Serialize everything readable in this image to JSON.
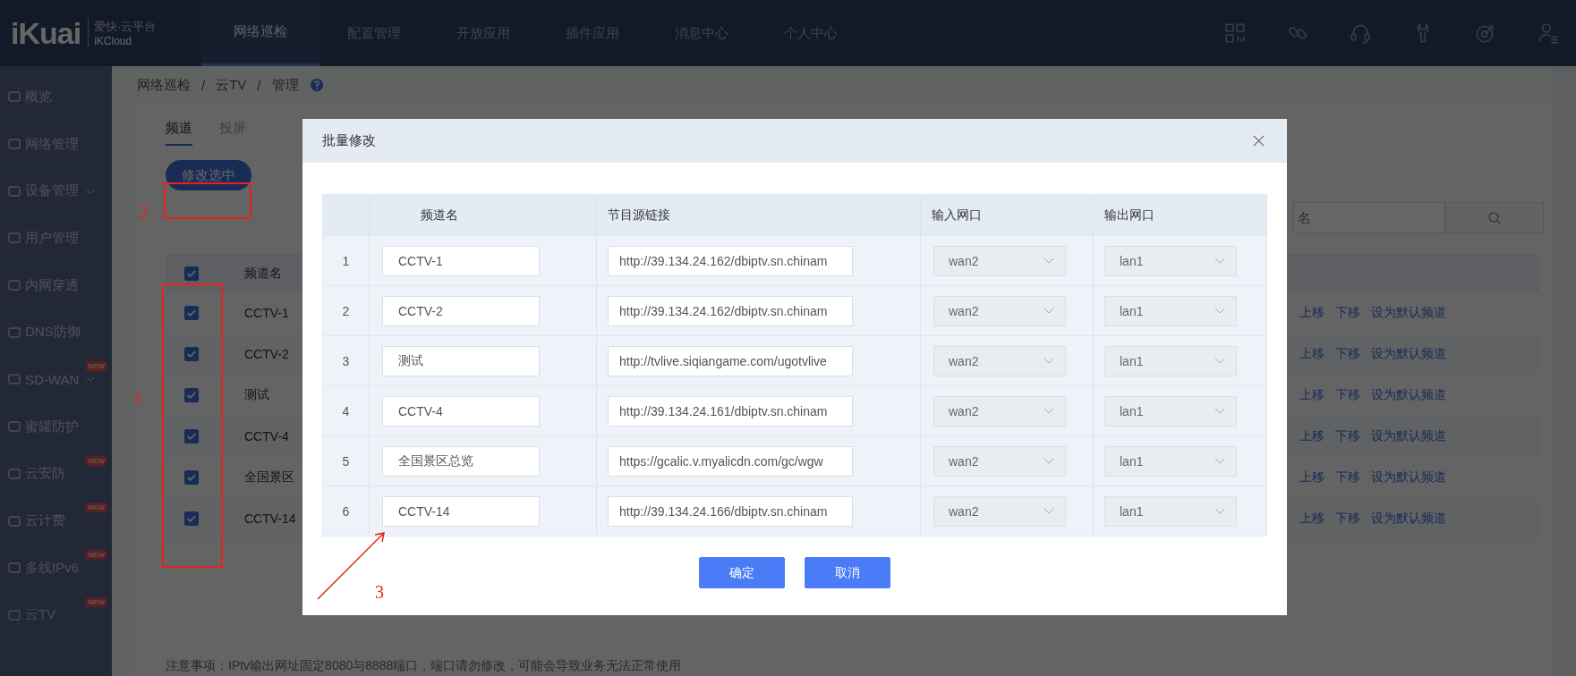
{
  "logo": {
    "mark": "iKuai",
    "title": "爱快·云平台",
    "subtitle": "iKCloud"
  },
  "nav": [
    {
      "label": "网络巡检",
      "selected": true
    },
    {
      "label": "配置管理",
      "selected": false
    },
    {
      "label": "开放应用",
      "selected": false
    },
    {
      "label": "插件应用",
      "selected": false
    },
    {
      "label": "消息中心",
      "selected": false
    },
    {
      "label": "个人中心",
      "selected": false
    }
  ],
  "sidebar": {
    "items": [
      {
        "label": "概览",
        "selected": false
      },
      {
        "label": "网络管理",
        "selected": false
      },
      {
        "label": "设备管理",
        "selected": false,
        "expandable": true
      },
      {
        "label": "用户管理",
        "selected": false
      },
      {
        "label": "内网穿透",
        "selected": false
      },
      {
        "label": "DNS防御",
        "selected": false
      },
      {
        "label": "SD-WAN",
        "selected": false,
        "expandable": true,
        "badge": "NEW"
      },
      {
        "label": "蜜罐防护",
        "selected": false
      },
      {
        "label": "云安防",
        "selected": false,
        "badge": "NEW"
      },
      {
        "label": "云计费",
        "selected": false,
        "badge": "NEW"
      },
      {
        "label": "多线IPv6",
        "selected": false,
        "badge": "NEW"
      },
      {
        "label": "云TV",
        "selected": true,
        "badge": "NEW"
      }
    ]
  },
  "breadcrumb": {
    "items": [
      "网络巡检",
      "云TV",
      "管理"
    ],
    "separator": "/"
  },
  "tabs": [
    {
      "label": "频道",
      "selected": true
    },
    {
      "label": "投屏",
      "selected": false
    }
  ],
  "modify_button": "修改选中",
  "search": {
    "placeholder": "名"
  },
  "table": {
    "header_checked": true,
    "columns": [
      "频道名"
    ],
    "rows": [
      {
        "name": "CCTV-1",
        "checked": true,
        "actions": [
          "上移",
          "下移",
          "设为默认频道"
        ]
      },
      {
        "name": "CCTV-2",
        "checked": true,
        "actions": [
          "上移",
          "下移",
          "设为默认频道"
        ]
      },
      {
        "name": "测试",
        "checked": true,
        "actions": [
          "上移",
          "下移",
          "设为默认频道"
        ]
      },
      {
        "name": "CCTV-4",
        "checked": true,
        "actions": [
          "上移",
          "下移",
          "设为默认频道"
        ]
      },
      {
        "name": "全国景区",
        "checked": true,
        "actions": [
          "上移",
          "下移",
          "设为默认频道"
        ]
      },
      {
        "name": "CCTV-14",
        "checked": true,
        "actions": [
          "上移",
          "下移",
          "设为默认频道"
        ]
      }
    ]
  },
  "note": "注意事项：IPtv输出网址固定8080与8888端口，端口请勿修改，可能会导致业务无法正常使用",
  "modal": {
    "title": "批量修改",
    "columns": [
      "频道名",
      "节目源链接",
      "输入网口",
      "输出网口"
    ],
    "rows": [
      {
        "index": "1",
        "name": "CCTV-1",
        "link": "http://39.134.24.162/dbiptv.sn.chinam",
        "input_port": {
          "value": "wan2",
          "disabled": true
        },
        "output_port": {
          "value": "lan1",
          "disabled": true
        }
      },
      {
        "index": "2",
        "name": "CCTV-2",
        "link": "http://39.134.24.162/dbiptv.sn.chinam",
        "input_port": {
          "value": "wan2",
          "disabled": true
        },
        "output_port": {
          "value": "lan1",
          "disabled": true
        }
      },
      {
        "index": "3",
        "name": "测试",
        "link": "http://tvlive.siqiangame.com/ugotvlive",
        "input_port": {
          "value": "wan2",
          "disabled": true
        },
        "output_port": {
          "value": "lan1",
          "disabled": true
        }
      },
      {
        "index": "4",
        "name": "CCTV-4",
        "link": "http://39.134.24.161/dbiptv.sn.chinam",
        "input_port": {
          "value": "wan2",
          "disabled": true
        },
        "output_port": {
          "value": "lan1",
          "disabled": true
        }
      },
      {
        "index": "5",
        "name": "全国景区总览",
        "link": "https://gcalic.v.myalicdn.com/gc/wgw",
        "input_port": {
          "value": "wan2",
          "disabled": true
        },
        "output_port": {
          "value": "lan1",
          "disabled": true
        }
      },
      {
        "index": "6",
        "name": "CCTV-14",
        "link": "http://39.134.24.166/dbiptv.sn.chinam",
        "input_port": {
          "value": "wan2",
          "disabled": true
        },
        "output_port": {
          "value": "lan1",
          "disabled": true
        }
      }
    ],
    "buttons": [
      {
        "label": "确定",
        "kind": "primary"
      },
      {
        "label": "取消",
        "kind": "primary"
      }
    ]
  },
  "annotations": [
    {
      "label": "1",
      "kind": "checkboxes"
    },
    {
      "label": "2",
      "kind": "button"
    },
    {
      "label": "3",
      "kind": "arrow"
    }
  ]
}
